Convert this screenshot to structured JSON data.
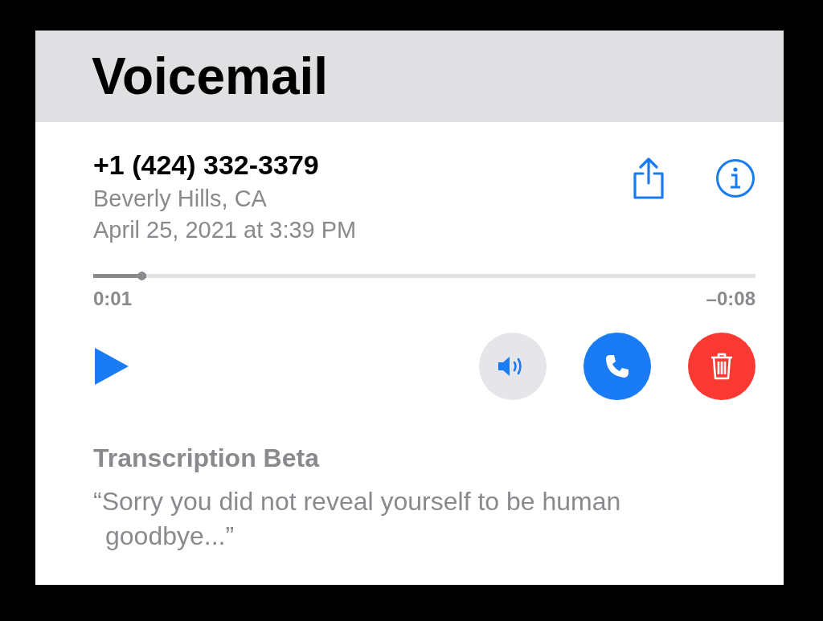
{
  "header": {
    "title": "Voicemail"
  },
  "message": {
    "caller": "+1 (424) 332-3379",
    "location": "Beverly Hills, CA",
    "date": "April 25, 2021 at 3:39 PM"
  },
  "playback": {
    "level": 0.08,
    "elapsed": "0:01",
    "remaining": "–0:08"
  },
  "transcription": {
    "title": "Transcription Beta",
    "text": "“Sorry you did not reveal yourself to be human goodbye...”"
  }
}
